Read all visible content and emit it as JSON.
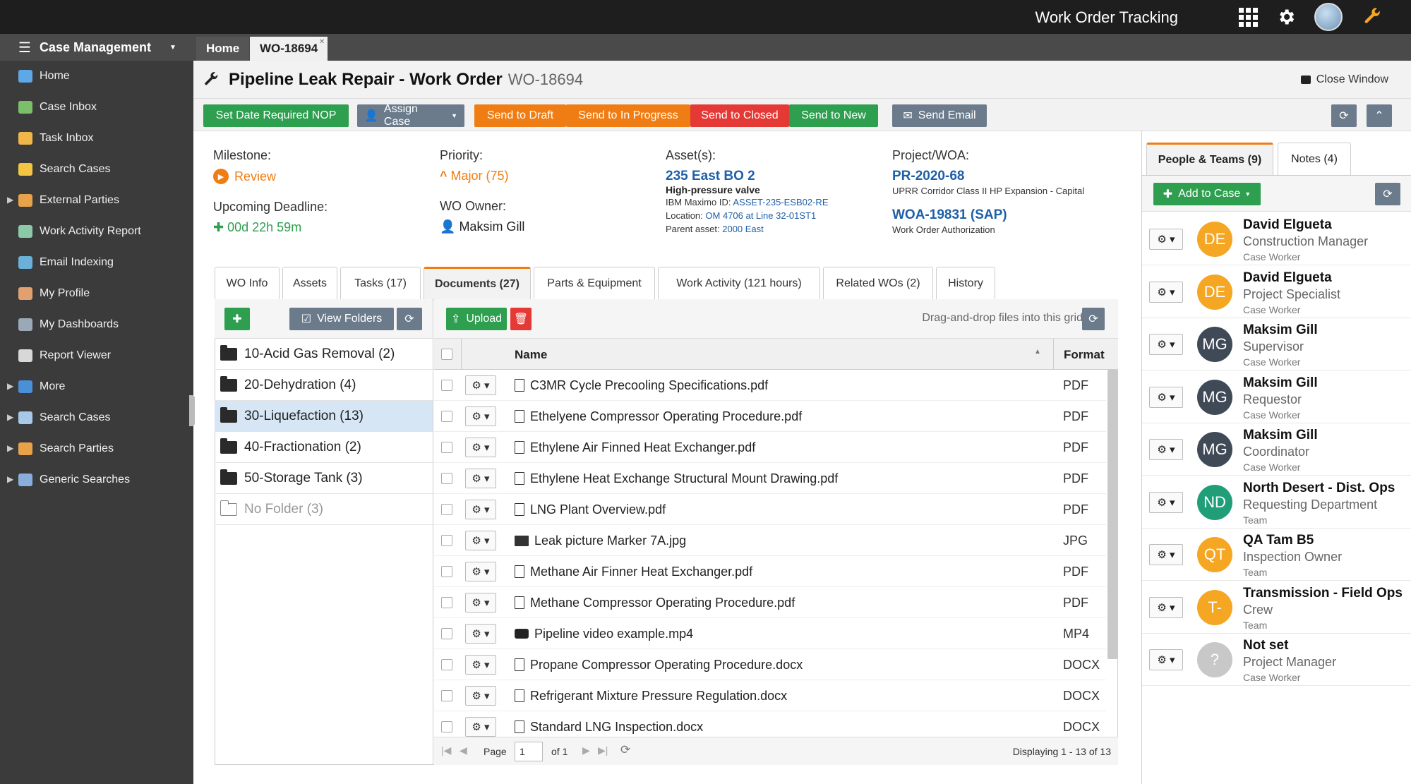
{
  "app": {
    "title": "Work Order Tracking"
  },
  "sidebar": {
    "header": "Case Management",
    "items": [
      {
        "label": "Home",
        "icon": "home-icon",
        "color": "#5fa8e8",
        "expandable": false
      },
      {
        "label": "Case Inbox",
        "icon": "inbox-icon",
        "color": "#7bbf6a",
        "expandable": false
      },
      {
        "label": "Task Inbox",
        "icon": "task-icon",
        "color": "#f0b64a",
        "expandable": false
      },
      {
        "label": "Search Cases",
        "icon": "folder-search-icon",
        "color": "#f4c542",
        "expandable": false
      },
      {
        "label": "External Parties",
        "icon": "people-icon",
        "color": "#e8a24a",
        "expandable": true
      },
      {
        "label": "Work Activity Report",
        "icon": "activity-icon",
        "color": "#8cc9a8",
        "expandable": false
      },
      {
        "label": "Email Indexing",
        "icon": "email-icon",
        "color": "#6ab0d8",
        "expandable": false
      },
      {
        "label": "My Profile",
        "icon": "profile-icon",
        "color": "#e0a070",
        "expandable": false
      },
      {
        "label": "My Dashboards",
        "icon": "dashboard-icon",
        "color": "#9aa8b8",
        "expandable": false
      },
      {
        "label": "Report Viewer",
        "icon": "report-icon",
        "color": "#d8d8d8",
        "expandable": false
      },
      {
        "label": "More",
        "icon": "code-icon",
        "color": "#4a90d9",
        "expandable": true
      },
      {
        "label": "Search Cases",
        "icon": "search-cases-icon",
        "color": "#a8c8e8",
        "expandable": true
      },
      {
        "label": "Search Parties",
        "icon": "search-parties-icon",
        "color": "#e8a24a",
        "expandable": true
      },
      {
        "label": "Generic Searches",
        "icon": "generic-search-icon",
        "color": "#8aaedc",
        "expandable": true
      }
    ]
  },
  "tabs": {
    "home": "Home",
    "active": "WO-18694"
  },
  "wo": {
    "title": "Pipeline Leak Repair - Work Order",
    "id": "WO-18694",
    "close_window": "Close Window"
  },
  "toolbar": {
    "set_date": "Set Date Required NOP",
    "assign_case": "Assign Case",
    "send_draft": "Send to Draft",
    "send_in_progress": "Send to In Progress",
    "send_closed": "Send to Closed",
    "send_new": "Send to New",
    "send_email": "Send Email"
  },
  "details": {
    "milestone_label": "Milestone:",
    "milestone_value": "Review",
    "deadline_label": "Upcoming Deadline:",
    "deadline_value": "00d 22h 59m",
    "priority_label": "Priority:",
    "priority_value": "Major (75)",
    "owner_label": "WO Owner:",
    "owner_value": "Maksim Gill",
    "asset_label": "Asset(s):",
    "asset_title": "235 East BO 2",
    "asset_sub": "High-pressure valve",
    "asset_maximo_label": "IBM Maximo ID:",
    "asset_maximo_value": "ASSET-235-ESB02-RE",
    "asset_location_label": "Location:",
    "asset_location_value": "OM 4706 at Line 32-01ST1",
    "asset_parent_label": "Parent asset:",
    "asset_parent_value": "2000 East",
    "project_label": "Project/WOA:",
    "project_title": "PR-2020-68",
    "project_sub": "UPRR Corridor Class II HP Expansion - Capital",
    "woa_title": "WOA-19831 (SAP)",
    "woa_sub": "Work Order Authorization"
  },
  "subtabs": [
    "WO Info",
    "Assets",
    "Tasks (17)",
    "Documents (27)",
    "Parts & Equipment",
    "Work Activity (121 hours)",
    "Related WOs (2)",
    "History"
  ],
  "folders": {
    "view_folders": "View Folders",
    "items": [
      {
        "name": "10-Acid Gas Removal (2)",
        "selected": false,
        "empty": false
      },
      {
        "name": "20-Dehydration (4)",
        "selected": false,
        "empty": false
      },
      {
        "name": "30-Liquefaction (13)",
        "selected": true,
        "empty": false
      },
      {
        "name": "40-Fractionation (2)",
        "selected": false,
        "empty": false
      },
      {
        "name": "50-Storage Tank (3)",
        "selected": false,
        "empty": false
      },
      {
        "name": "No Folder (3)",
        "selected": false,
        "empty": true
      }
    ]
  },
  "documents": {
    "upload": "Upload",
    "dnd_hint": "Drag-and-drop files into this grid",
    "col_name": "Name",
    "col_format": "Format",
    "rows": [
      {
        "name": "C3MR Cycle Precooling Specifications.pdf",
        "format": "PDF",
        "kind": "pdf"
      },
      {
        "name": "Ethelyene Compressor Operating Procedure.pdf",
        "format": "PDF",
        "kind": "pdf"
      },
      {
        "name": "Ethylene Air Finned Heat Exchanger.pdf",
        "format": "PDF",
        "kind": "pdf"
      },
      {
        "name": "Ethylene Heat Exchange Structural Mount Drawing.pdf",
        "format": "PDF",
        "kind": "pdf"
      },
      {
        "name": "LNG Plant Overview.pdf",
        "format": "PDF",
        "kind": "pdf"
      },
      {
        "name": "Leak picture Marker 7A.jpg",
        "format": "JPG",
        "kind": "img"
      },
      {
        "name": "Methane Air Finner Heat Exchanger.pdf",
        "format": "PDF",
        "kind": "pdf"
      },
      {
        "name": "Methane Compressor Operating Procedure.pdf",
        "format": "PDF",
        "kind": "pdf"
      },
      {
        "name": "Pipeline video example.mp4",
        "format": "MP4",
        "kind": "vid"
      },
      {
        "name": "Propane Compressor Operating Procedure.docx",
        "format": "DOCX",
        "kind": "doc"
      },
      {
        "name": "Refrigerant Mixture Pressure Regulation.docx",
        "format": "DOCX",
        "kind": "doc"
      },
      {
        "name": "Standard LNG Inspection.docx",
        "format": "DOCX",
        "kind": "doc"
      }
    ],
    "pager": {
      "page_label": "Page",
      "page": "1",
      "of": "of 1",
      "displaying": "Displaying 1 - 13 of 13"
    }
  },
  "right": {
    "tab_people": "People & Teams (9)",
    "tab_notes": "Notes (4)",
    "add_to_case": "Add to Case",
    "people": [
      {
        "initials": "DE",
        "name": "David Elgueta",
        "role": "Construction Manager",
        "type": "Case Worker",
        "color": "#f5a623"
      },
      {
        "initials": "DE",
        "name": "David Elgueta",
        "role": "Project Specialist",
        "type": "Case Worker",
        "color": "#f5a623"
      },
      {
        "initials": "MG",
        "name": "Maksim Gill",
        "role": "Supervisor",
        "type": "Case Worker",
        "color": "#3f4a56"
      },
      {
        "initials": "MG",
        "name": "Maksim Gill",
        "role": "Requestor",
        "type": "Case Worker",
        "color": "#3f4a56"
      },
      {
        "initials": "MG",
        "name": "Maksim Gill",
        "role": "Coordinator",
        "type": "Case Worker",
        "color": "#3f4a56"
      },
      {
        "initials": "ND",
        "name": "North Desert - Dist. Ops",
        "role": "Requesting Department",
        "type": "Team",
        "color": "#1f9e78"
      },
      {
        "initials": "QT",
        "name": "QA Tam B5",
        "role": "Inspection Owner",
        "type": "Team",
        "color": "#f5a623"
      },
      {
        "initials": "T-",
        "name": "Transmission - Field Ops",
        "role": "Crew",
        "type": "Team",
        "color": "#f5a623"
      },
      {
        "initials": "?",
        "name": "Not set",
        "role": "Project Manager",
        "type": "Case Worker",
        "color": "#c8c8c8"
      }
    ]
  }
}
